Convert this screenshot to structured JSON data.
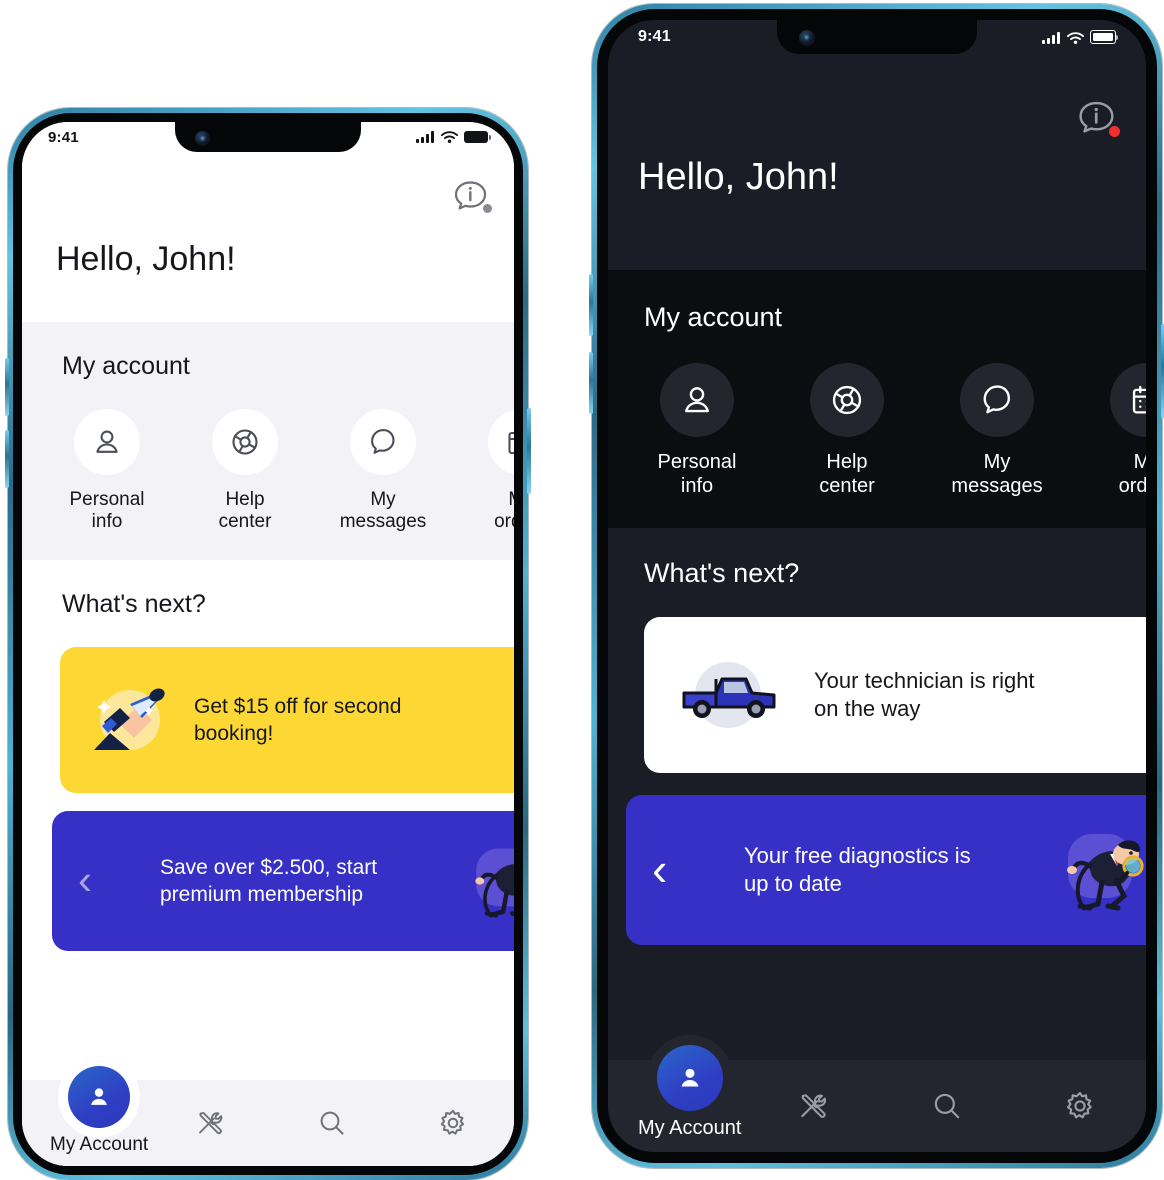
{
  "meta": {
    "accent_blue": "#3730C6",
    "accent_yellow": "#FDD835",
    "light_bg": "#FFFFFF",
    "light_section_bg": "#F2F2F7",
    "dark_bg": "#0C0D11",
    "dark_header_bg": "#1B1D26",
    "badge_red": "#F03030",
    "badge_gray": "#8A8A93"
  },
  "phones": [
    {
      "id": "light",
      "theme": "light",
      "status": {
        "time": "9:41",
        "signal_icon": "cellular-bars-icon",
        "wifi_icon": "wifi-icon",
        "battery_icon": "battery-icon"
      },
      "header": {
        "greeting": "Hello, John!",
        "info_icon": "info-chat-icon",
        "badge_color": "#8A8A93"
      },
      "account": {
        "title": "My account",
        "tiles": [
          {
            "label": "Personal\ninfo",
            "icon": "person-icon"
          },
          {
            "label": "Help\ncenter",
            "icon": "lifebuoy-icon"
          },
          {
            "label": "My\nmessages",
            "icon": "chat-bubble-icon"
          },
          {
            "label": "My\norders",
            "icon": "calendar-icon"
          }
        ]
      },
      "whats_next": {
        "title": "What's next?",
        "cards": [
          {
            "style": "yellow",
            "text": "Get $15 off for second booking!",
            "illustration": "megaphone-icon",
            "chevron": "right"
          },
          {
            "style": "blue",
            "text": "Save over $2.500, start premium membership",
            "illustration": "detective-icon",
            "chevron": "left"
          }
        ]
      },
      "nav": {
        "account_label": "My Account",
        "account_icon": "person-icon",
        "items": [
          {
            "icon": "tools-icon"
          },
          {
            "icon": "search-icon"
          },
          {
            "icon": "gear-icon"
          }
        ]
      }
    },
    {
      "id": "dark",
      "theme": "dark",
      "status": {
        "time": "9:41",
        "signal_icon": "cellular-bars-icon",
        "wifi_icon": "wifi-icon",
        "battery_icon": "battery-icon"
      },
      "header": {
        "greeting": "Hello, John!",
        "info_icon": "info-chat-icon",
        "badge_color": "#F03030"
      },
      "account": {
        "title": "My account",
        "tiles": [
          {
            "label": "Personal\ninfo",
            "icon": "person-icon"
          },
          {
            "label": "Help\ncenter",
            "icon": "lifebuoy-icon"
          },
          {
            "label": "My\nmessages",
            "icon": "chat-bubble-icon"
          },
          {
            "label": "My\norders",
            "icon": "calendar-icon"
          }
        ]
      },
      "whats_next": {
        "title": "What's next?",
        "cards": [
          {
            "style": "white",
            "text": "Your technician is right on the way",
            "illustration": "pickup-truck-icon",
            "chevron": "right"
          },
          {
            "style": "blue",
            "text": "Your free diagnostics is up to date",
            "illustration": "detective-icon",
            "chevron": "left"
          }
        ]
      },
      "nav": {
        "account_label": "My Account",
        "account_icon": "person-icon",
        "items": [
          {
            "icon": "tools-icon"
          },
          {
            "icon": "search-icon"
          },
          {
            "icon": "gear-icon"
          }
        ]
      }
    }
  ]
}
